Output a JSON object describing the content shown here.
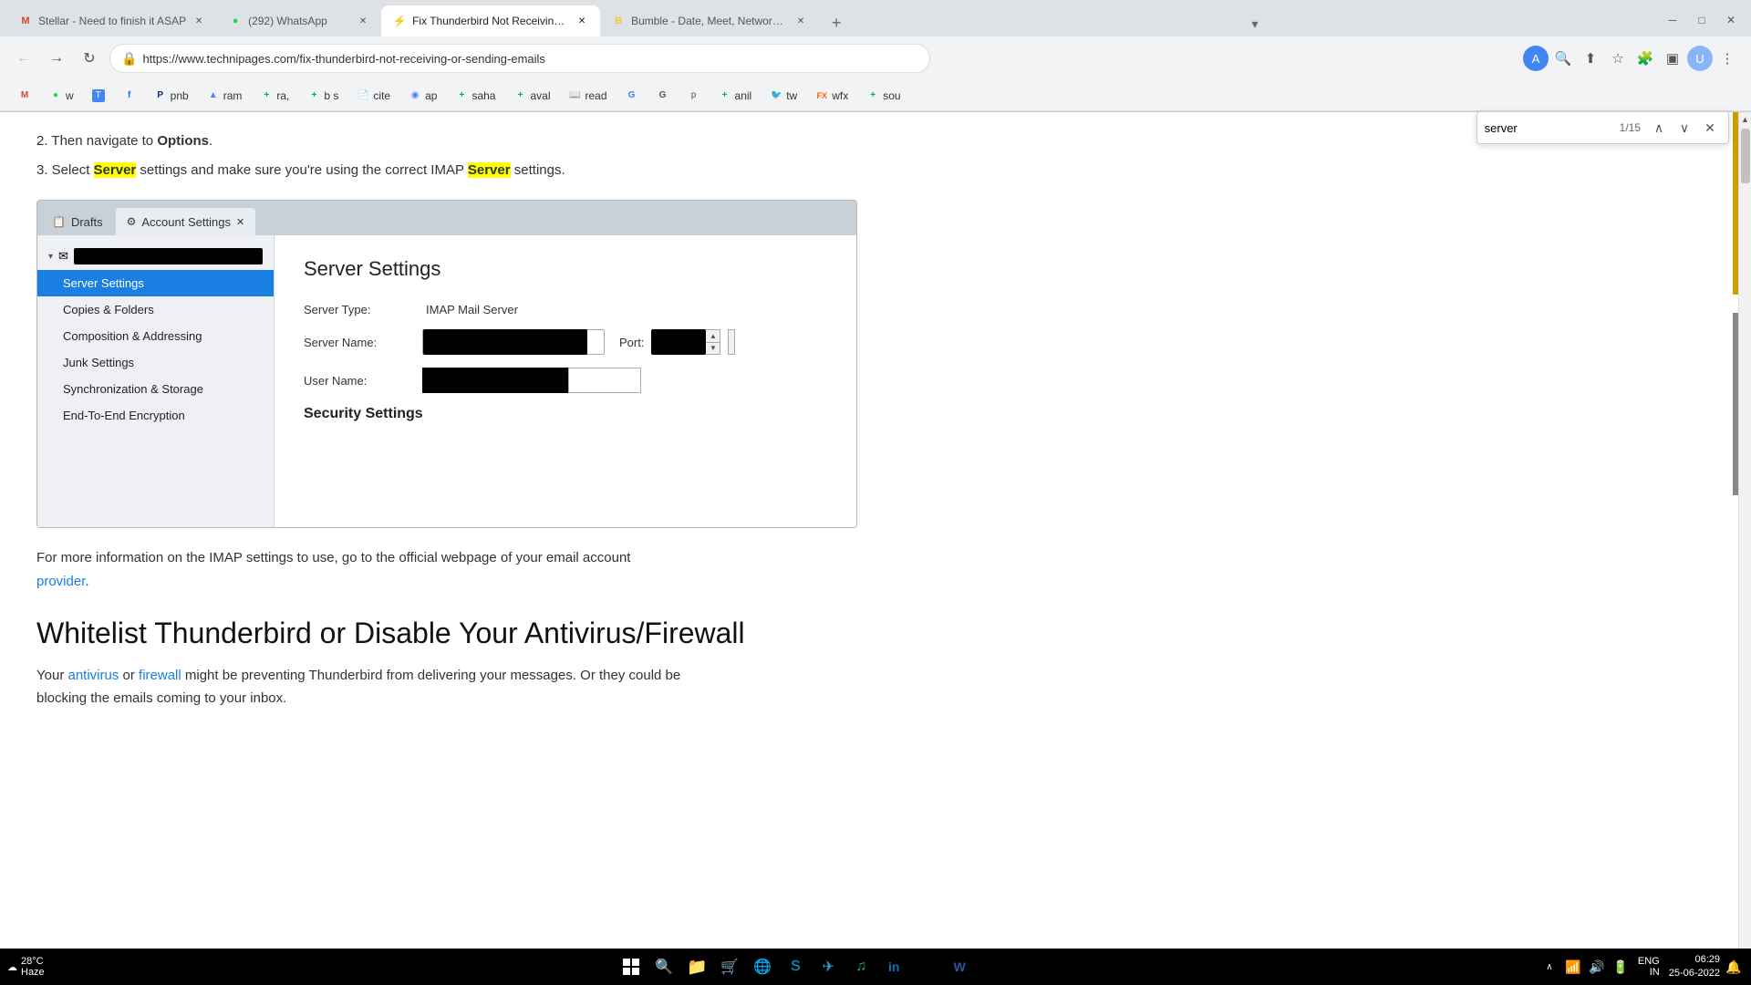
{
  "browser": {
    "tabs": [
      {
        "id": "tab1",
        "favicon": "M",
        "favicon_color": "#d44638",
        "title": "Stellar - Need to finish it ASAP",
        "active": false
      },
      {
        "id": "tab2",
        "favicon": "W",
        "favicon_color": "#25d366",
        "title": "(292) WhatsApp",
        "active": false
      },
      {
        "id": "tab3",
        "favicon": "T",
        "favicon_color": "#1a73e8",
        "title": "Fix Thunderbird Not Receiving o...",
        "active": true
      },
      {
        "id": "tab4",
        "favicon": "B",
        "favicon_color": "#ffc629",
        "title": "Bumble - Date, Meet, Network B...",
        "active": false
      }
    ],
    "url": "https://www.technipages.com/fix-thunderbird-not-receiving-or-sending-emails",
    "find": {
      "query": "server",
      "count": "1/15"
    }
  },
  "bookmarks": [
    {
      "label": "G",
      "favicon": "G",
      "color": "#d44638"
    },
    {
      "label": "w",
      "favicon": "w",
      "color": "#25d366"
    },
    {
      "label": "T",
      "favicon": "T",
      "color": "#4285f4"
    },
    {
      "label": "f",
      "favicon": "f",
      "color": "#1877f2"
    },
    {
      "label": "pnb",
      "favicon": "p",
      "color": "#003087"
    },
    {
      "label": "ram",
      "favicon": "G",
      "color": "#4285f4"
    },
    {
      "label": "ra,",
      "favicon": "+",
      "color": "#00b050"
    },
    {
      "label": "b s",
      "favicon": "+",
      "color": "#00b050"
    },
    {
      "label": "cite",
      "favicon": "c",
      "color": "#555"
    },
    {
      "label": "ap",
      "favicon": "A",
      "color": "#4285f4"
    },
    {
      "label": "saha",
      "favicon": "+",
      "color": "#00b050"
    },
    {
      "label": "aval",
      "favicon": "+",
      "color": "#00b050"
    },
    {
      "label": "read",
      "favicon": "r",
      "color": "#555"
    },
    {
      "label": "G",
      "favicon": "G",
      "color": "#555"
    },
    {
      "label": "G",
      "favicon": "G",
      "color": "#555"
    },
    {
      "label": "p",
      "favicon": "p",
      "color": "#555"
    },
    {
      "label": "anil",
      "favicon": "+",
      "color": "#00b050"
    },
    {
      "label": "tw",
      "favicon": "t",
      "color": "#1da1f2"
    },
    {
      "label": "wfx",
      "favicon": "FX",
      "color": "#ff6600"
    },
    {
      "label": "sou",
      "favicon": "+",
      "color": "#00b050"
    }
  ],
  "page": {
    "step2": "2. Then navigate to ",
    "step2_bold": "Options",
    "step2_end": ".",
    "step3_pre": "3. Select ",
    "step3_highlight": "Server",
    "step3_mid": " settings and make sure you're using the correct IMAP ",
    "step3_highlight2": "Server",
    "step3_end": " settings.",
    "thunderbird": {
      "tabs": [
        {
          "label": "Drafts",
          "icon": "📋",
          "active": false
        },
        {
          "label": "Account Settings",
          "icon": "⚙",
          "active": true
        }
      ],
      "sidebar": {
        "account_name": "",
        "menu_items": [
          {
            "label": "Server Settings",
            "active": true
          },
          {
            "label": "Copies & Folders",
            "active": false
          },
          {
            "label": "Composition & Addressing",
            "active": false
          },
          {
            "label": "Junk Settings",
            "active": false
          },
          {
            "label": "Synchronization & Storage",
            "active": false
          },
          {
            "label": "End-To-End Encryption",
            "active": false
          }
        ]
      },
      "main": {
        "title": "Server Settings",
        "server_type_label": "Server Type:",
        "server_type_value": "IMAP Mail Server",
        "server_name_label": "Server Name:",
        "port_label": "Port:",
        "user_name_label": "User Name:",
        "security_title": "Security Settings"
      }
    },
    "info_text_pre": "For more information on the IMAP settings to use, go to the official webpage of your email account",
    "info_link": "provider",
    "info_text_end": ".",
    "section_heading": "Whitelist Thunderbird or Disable Your Antivirus/Firewall",
    "body_text_pre": "Your ",
    "body_link1": "antivirus",
    "body_text_mid": " or ",
    "body_link2": "firewall",
    "body_text_mid2": " might be preventing Thunderbird from delivering your messages. Or they could be",
    "body_text_end": "blocking the emails coming to your inbox."
  },
  "taskbar": {
    "weather_temp": "28°C",
    "weather_condition": "Haze",
    "lang": "ENG",
    "region": "IN",
    "time": "06:29",
    "date": "25-06-2022"
  }
}
